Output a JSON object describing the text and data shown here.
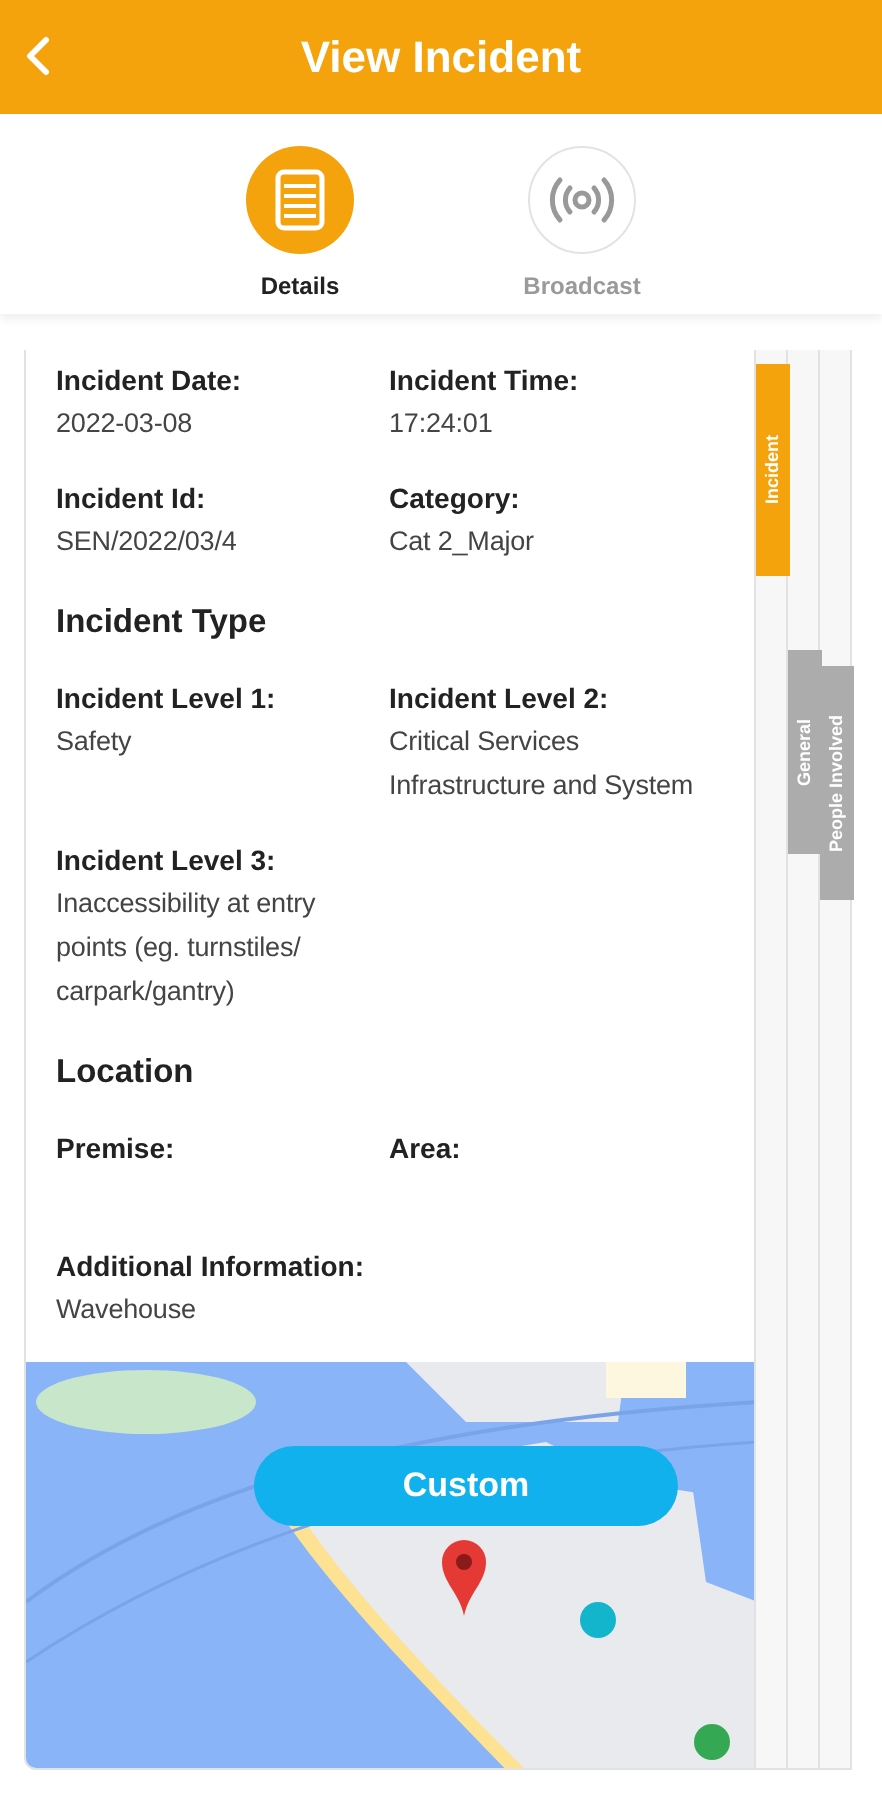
{
  "header": {
    "title": "View Incident"
  },
  "tabs": [
    {
      "label": "Details",
      "selected": true,
      "kind": "details"
    },
    {
      "label": "Broadcast",
      "selected": false,
      "kind": "broadcast"
    }
  ],
  "sections": [
    {
      "fields": [
        {
          "label": "Incident Date:",
          "value": "2022-03-08"
        },
        {
          "label": "Incident Time:",
          "value": "17:24:01"
        },
        {
          "label": "Incident Id:",
          "value": "SEN/2022/03/4"
        },
        {
          "label": "Category:",
          "value": "Cat 2_Major"
        }
      ]
    },
    {
      "heading": "Incident Type",
      "fields": [
        {
          "label": "Incident Level 1:",
          "value": "Safety"
        },
        {
          "label": "Incident Level 2:",
          "value": "Critical Services Infrastructure and System"
        },
        {
          "label": "Incident Level 3:",
          "value": "Inaccessibility at entry points (eg. turnstiles/ carpark/gantry)"
        }
      ]
    },
    {
      "heading": "Location",
      "fields": [
        {
          "label": "Premise:"
        },
        {
          "label": "Area:"
        },
        {
          "label": "Additional Information:",
          "value": "Wavehouse"
        }
      ]
    }
  ],
  "map": {
    "kind": "picture",
    "button": "Custom"
  },
  "side_tabs": [
    {
      "label": "Incident",
      "selected": true
    },
    {
      "label": "General",
      "selected": false
    },
    {
      "label": "People Involved",
      "selected": false
    }
  ]
}
